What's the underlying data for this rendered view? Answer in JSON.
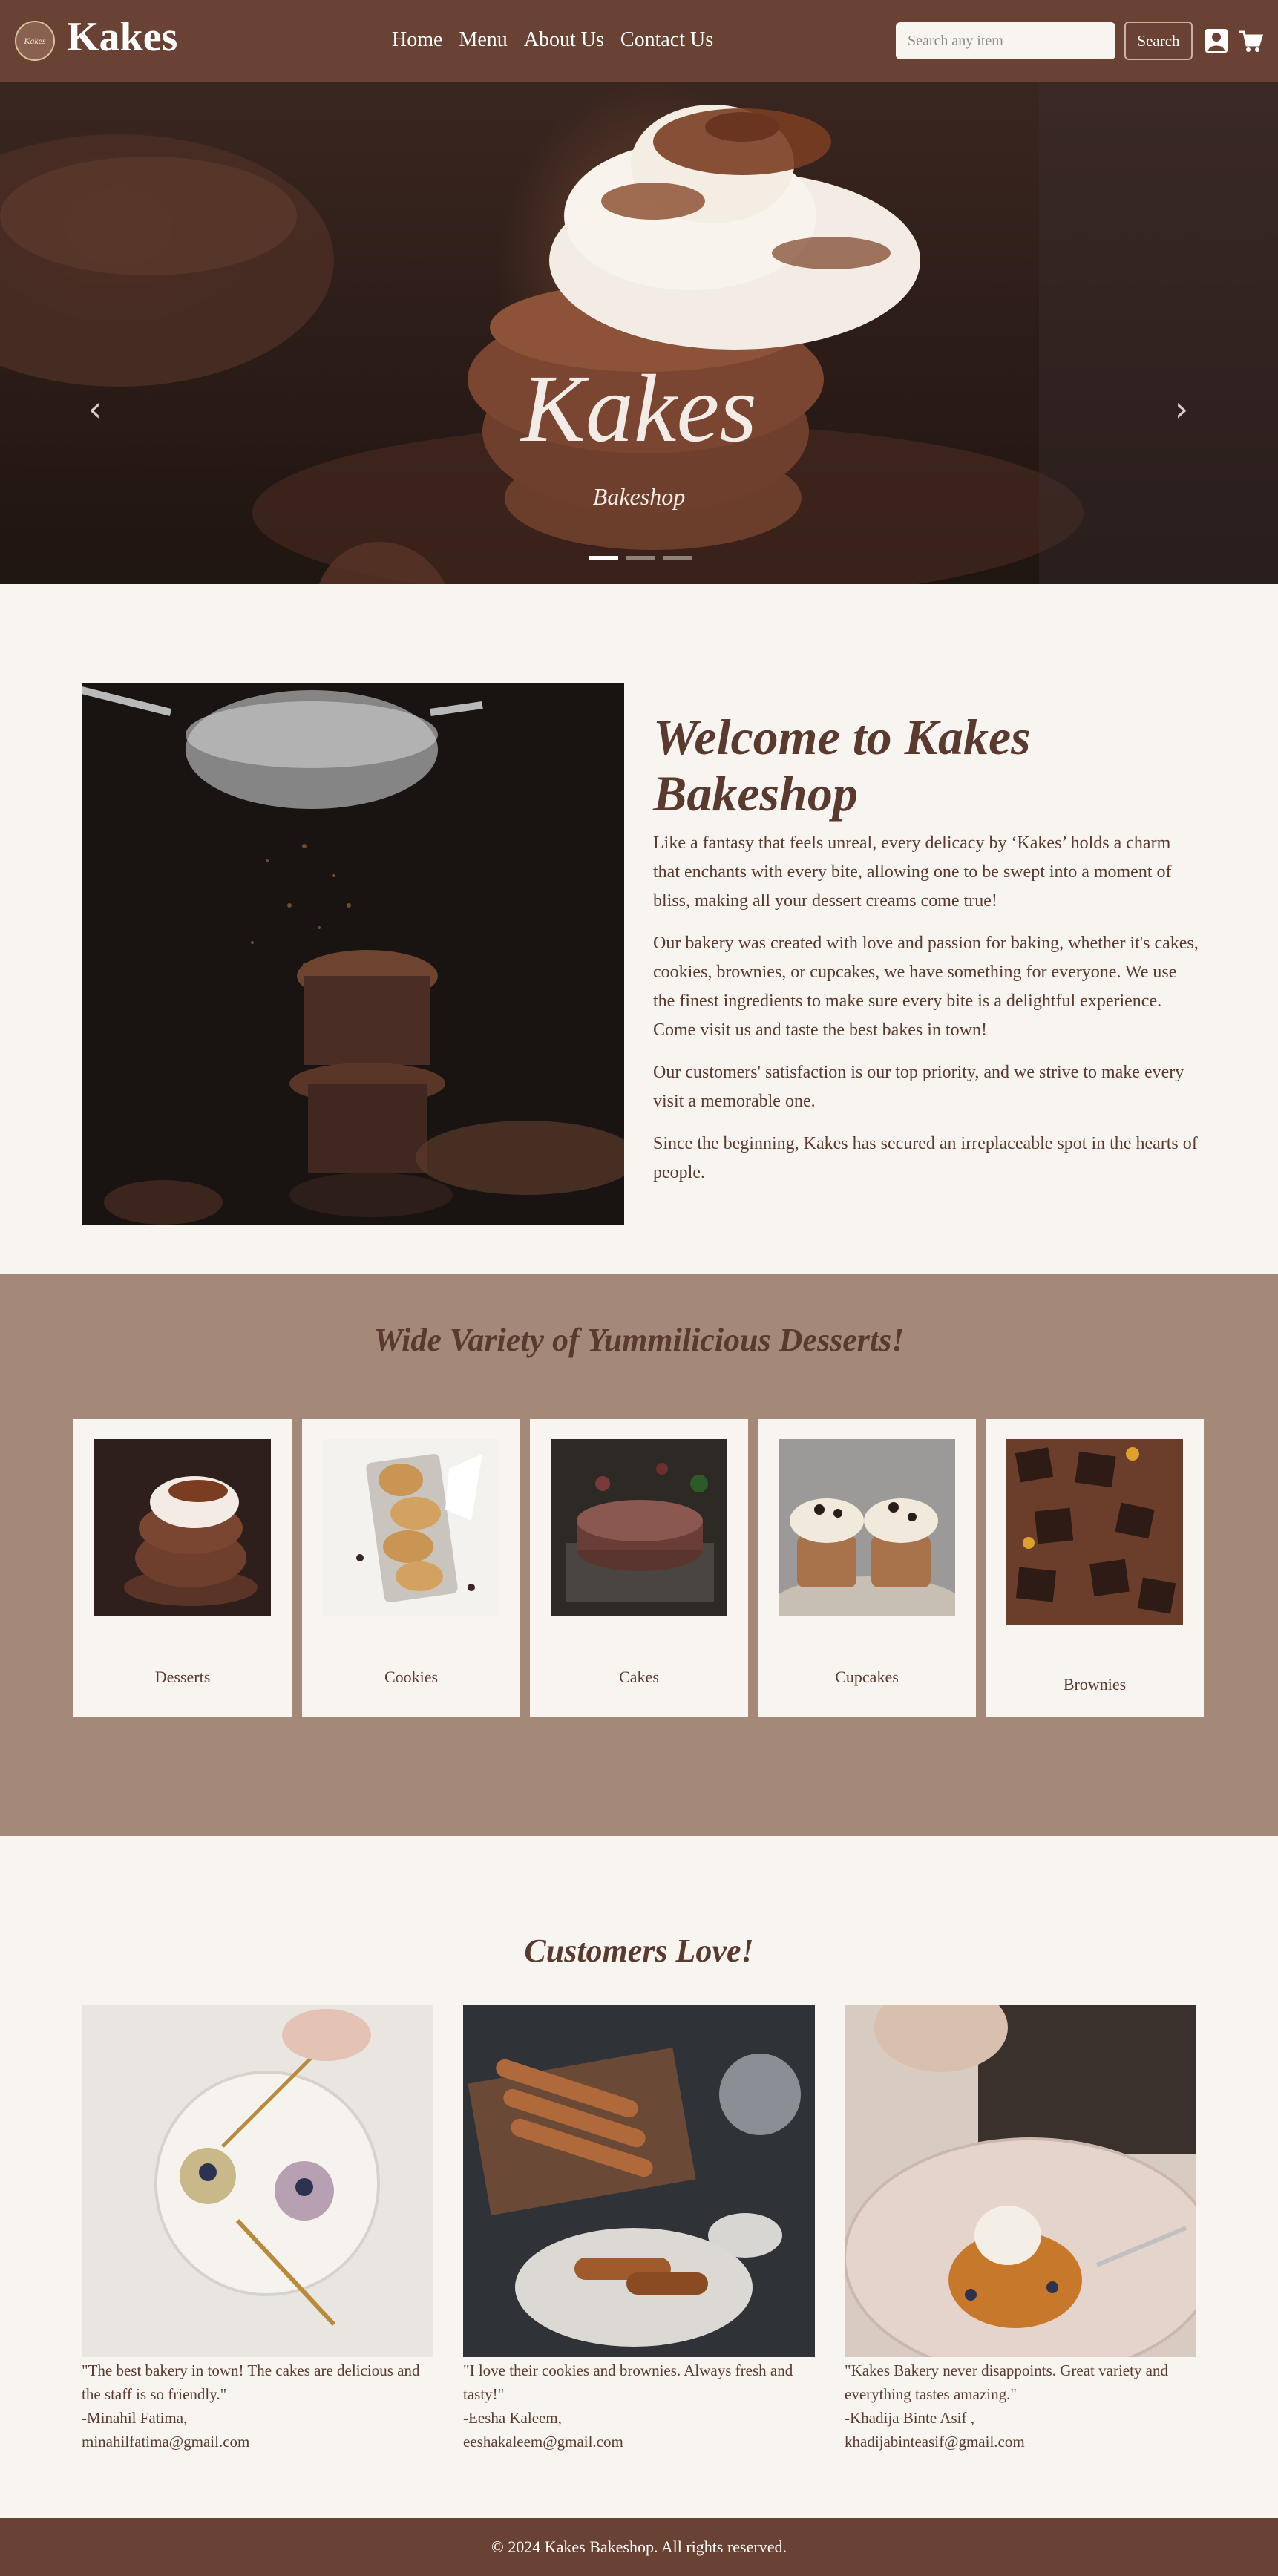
{
  "navbar": {
    "brand": "Kakes",
    "logo_text": "Kakes",
    "links": [
      "Home",
      "Menu",
      "About Us",
      "Contact Us"
    ],
    "search_placeholder": "Search any item",
    "search_button": "Search",
    "icons": [
      "user-icon",
      "cart-icon"
    ]
  },
  "hero": {
    "title": "Kakes",
    "subtitle": "Bakeshop",
    "prev_arrow": "‹",
    "next_arrow": "›",
    "slides_count": 3,
    "active_slide": 1
  },
  "welcome": {
    "title": "Welcome to Kakes Bakeshop",
    "paragraphs": [
      "Like a fantasy that feels unreal, every delicacy by ‘Kakes’ holds a charm that enchants with every bite, allowing one to be swept into a moment of bliss, making all your dessert creams come true!",
      "Our bakery was created with love and passion for baking, whether it's cakes, cookies, brownies, or cupcakes, we have something for everyone. We use the finest ingredients to make sure every bite is a delightful experience. Come visit us and taste the best bakes in town!",
      "Our customers' satisfaction is our top priority, and we strive to make every visit a memorable one.",
      "Since the beginning, Kakes has secured an irreplaceable spot in the hearts of people."
    ]
  },
  "variety": {
    "title": "Wide Variety of Yummilicious Desserts!",
    "cards": [
      "Desserts",
      "Cookies",
      "Cakes",
      "Cupcakes",
      "Brownies"
    ]
  },
  "customers": {
    "title": "Customers Love!",
    "reviews": [
      {
        "quote": "\"The best bakery in town! The cakes are delicious and the staff is so friendly.\"",
        "name": "-Minahil Fatima,",
        "email": "minahilfatima@gmail.com"
      },
      {
        "quote": "\"I love their cookies and brownies. Always fresh and tasty!\"",
        "name": "-Eesha Kaleem,",
        "email": "eeshakaleem@gmail.com"
      },
      {
        "quote": "\"Kakes Bakery never disappoints. Great variety and everything tastes amazing.\"",
        "name": "-Khadija Binte Asif ,",
        "email": "khadijabinteasif@gmail.com"
      }
    ]
  },
  "footer": {
    "text": "© 2024 Kakes Bakeshop. All rights reserved."
  },
  "colors": {
    "navbar": "#6a4234",
    "page_background": "#f8f4f0",
    "variety_background": "#a48979",
    "heading_text": "#5a3a2e"
  }
}
